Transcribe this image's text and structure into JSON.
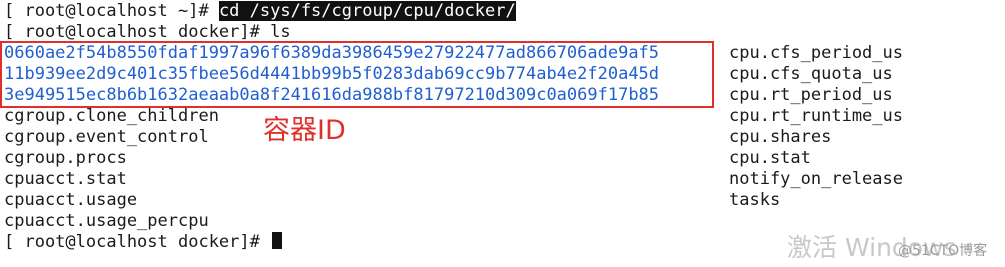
{
  "terminal": {
    "line1": {
      "prompt": "[ root@localhost ~]# ",
      "command": "cd /sys/fs/cgroup/cpu/docker/"
    },
    "line2": {
      "prompt": "[ root@localhost docker]# ",
      "command": "ls"
    },
    "container_ids": [
      "0660ae2f54b8550fdaf1997a96f6389da3986459e27922477ad866706ade9af5",
      "11b939ee2d9c401c35fbee56d4441bb99b5f0283dab69cc9b774ab4e2f20a45d",
      "3e949515ec8b6b1632aeaab0a8f241616da988bf81797210d309c0a069f17b85"
    ],
    "left_files": [
      "cgroup.clone_children",
      "cgroup.event_control",
      "cgroup.procs",
      "cpuacct.stat",
      "cpuacct.usage",
      "cpuacct.usage_percpu"
    ],
    "right_files": [
      "cpu.cfs_period_us",
      "cpu.cfs_quota_us",
      "cpu.rt_period_us",
      "cpu.rt_runtime_us",
      "cpu.shares",
      "cpu.stat",
      "notify_on_release",
      "tasks"
    ],
    "final_prompt": "[ root@localhost docker]# "
  },
  "annotation": {
    "label": "容器ID",
    "color": "#e0302c"
  },
  "watermark": {
    "text": "激活 Windows",
    "site": "@51CTO博客"
  },
  "colors": {
    "id_text": "#1f5fd1",
    "background": "#ffffff"
  }
}
